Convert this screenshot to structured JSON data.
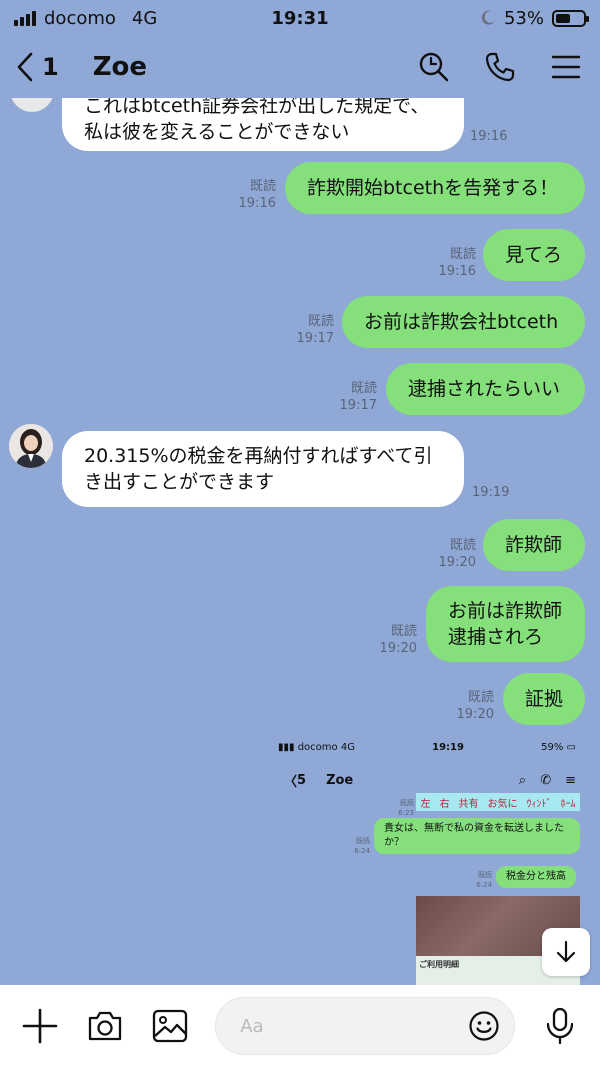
{
  "status": {
    "carrier": "docomo",
    "network": "4G",
    "time": "19:31",
    "battery": "53%",
    "battery_level": 0.53
  },
  "header": {
    "back_count": "1",
    "title": "Zoe"
  },
  "messages": [
    {
      "dir": "in",
      "text_line1": "これはbtceth証券会社が出した規定で、",
      "text_line2": "私は彼を変えることができない",
      "time": "19:16"
    },
    {
      "dir": "out",
      "read": "既読",
      "time": "19:16",
      "text": "詐欺開始btcethを告発する！"
    },
    {
      "dir": "out",
      "read": "既読",
      "time": "19:16",
      "text": "見てろ"
    },
    {
      "dir": "out",
      "read": "既読",
      "time": "19:17",
      "text": "お前は詐欺会社btceth"
    },
    {
      "dir": "out",
      "read": "既読",
      "time": "19:17",
      "text": "逮捕されたらいい"
    },
    {
      "dir": "in",
      "text_line1": "20.315%の税金を再納付すればすべて引",
      "text_line2": "き出すことができます",
      "time": "19:19"
    },
    {
      "dir": "out",
      "read": "既読",
      "time": "19:20",
      "text": "詐欺師"
    },
    {
      "dir": "out",
      "read": "既読",
      "time": "19:20",
      "text_line1": "お前は詐欺師",
      "text_line2": "逮捕されろ"
    },
    {
      "dir": "out",
      "read": "既読",
      "time": "19:20",
      "text": "証拠"
    }
  ],
  "screenshot": {
    "carrier": "docomo",
    "network": "4G",
    "time": "19:19",
    "battery": "59%",
    "back_count": "5",
    "title": "Zoe",
    "strip_labels": [
      "左",
      "右",
      "共有",
      "お気に",
      "ｳｨﾝﾄﾞ",
      "ﾎｰﾑ"
    ],
    "msg1_read": "既読",
    "msg1_time": "6:23",
    "msg2_read": "既読",
    "msg2_time": "6:24",
    "msg2_line1": "貴女は、無断で私の資金を転送しました",
    "msg2_line2": "か？",
    "msg3_read": "既読",
    "msg3_time": "6:24",
    "msg3_text": "税金分と残高",
    "photo_caption": "ご利用明細"
  },
  "input": {
    "placeholder": "Aa"
  },
  "colors": {
    "background": "#8fa8d6",
    "out_bubble": "#85e07c",
    "in_bubble": "#ffffff"
  }
}
